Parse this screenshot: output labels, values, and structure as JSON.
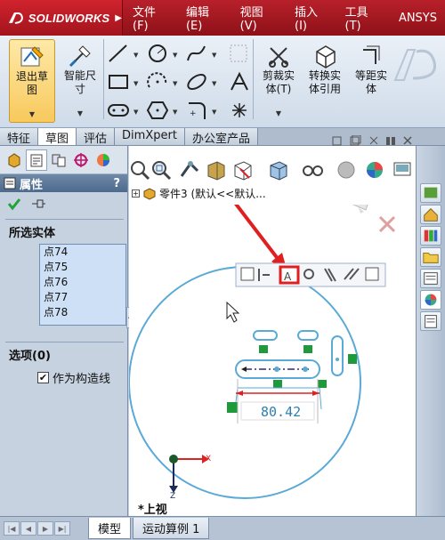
{
  "app": {
    "logo_text": "SOLIDWORKS"
  },
  "menu": [
    "文件(F)",
    "编辑(E)",
    "视图(V)",
    "插入(I)",
    "工具(T)",
    "ANSYS"
  ],
  "ribbon": {
    "exit_sketch": [
      "退出草",
      "图"
    ],
    "smart_dim": [
      "智能尺",
      "寸"
    ],
    "trim": [
      "剪裁实",
      "体(T)"
    ],
    "convert": [
      "转换实",
      "体引用"
    ],
    "offset": [
      "等距实",
      "体"
    ]
  },
  "tabs": [
    "特征",
    "草图",
    "评估",
    "DimXpert",
    "办公室产品"
  ],
  "active_tab": 1,
  "panel": {
    "title": "属性",
    "help": "?",
    "selected_title": "所选实体",
    "selected_items": [
      "点74",
      "点75",
      "点76",
      "点77",
      "点78"
    ],
    "options_title": "选项(0)",
    "construction_label": "作为构造线",
    "construction_checked": true
  },
  "viewport": {
    "tree_label": "零件3 (默认<<默认...",
    "dimension": "80.42",
    "view_name": "*上视",
    "axis_x": "X",
    "axis_z": "Z"
  },
  "bottom_tabs": [
    "模型",
    "运动算例 1"
  ],
  "bottom_active": 0,
  "colors": {
    "title_red": "#b8202a",
    "arrow_red": "#e02020",
    "sketch_blue": "#5aa9d6",
    "relation_green": "#1f9a3a",
    "dimension_blue": "#2e7fb0"
  }
}
